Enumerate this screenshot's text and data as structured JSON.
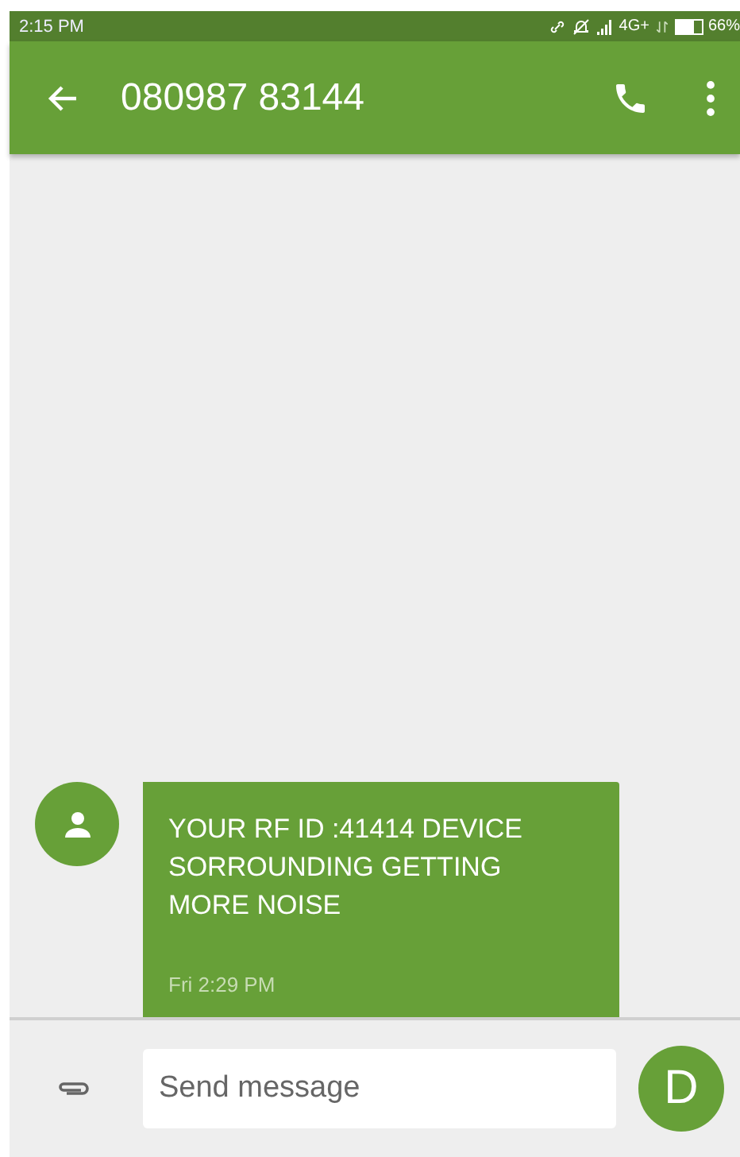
{
  "status_bar": {
    "time": "2:15 PM",
    "network": "4G+",
    "battery": "66%"
  },
  "toolbar": {
    "title": "080987 83144"
  },
  "messages": [
    {
      "text": "YOUR RF ID :41414 DEVICE SORROUNDING GETTING MORE NOISE",
      "time": "Fri 2:29 PM"
    }
  ],
  "composer": {
    "placeholder": "Send message",
    "send_label": "D"
  }
}
